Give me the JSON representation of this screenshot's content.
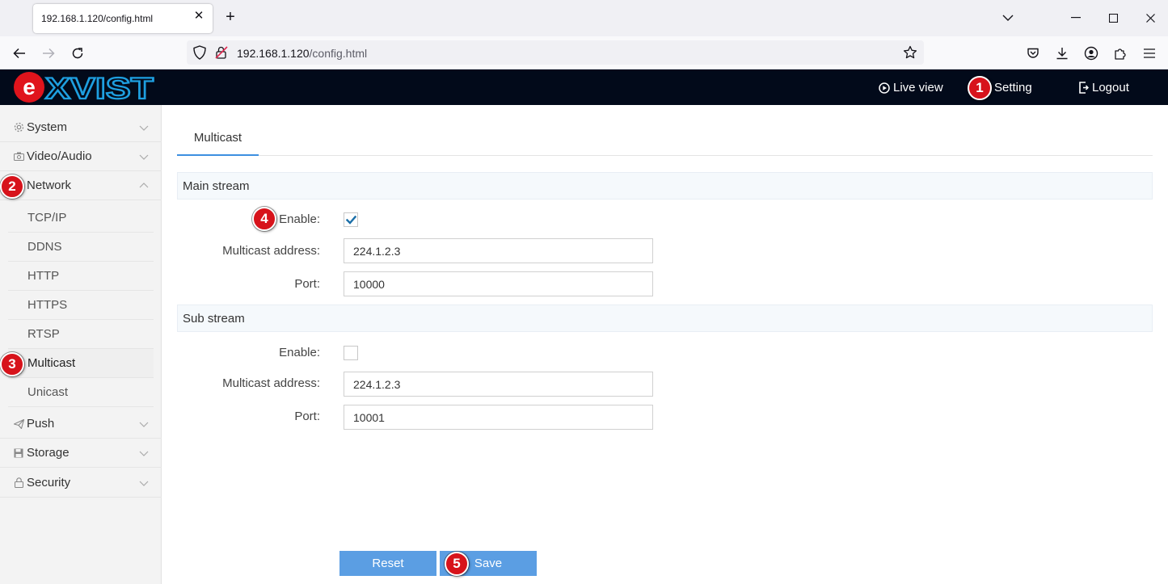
{
  "browser": {
    "tab_title": "192.168.1.120/config.html",
    "url_host": "192.168.1.120",
    "url_path": "/config.html"
  },
  "header": {
    "logo_text": "eXVIST",
    "live_view": "Live view",
    "setting": "Setting",
    "logout": "Logout"
  },
  "sidebar": {
    "items": [
      {
        "label": "System",
        "icon": "gear-icon",
        "expanded": false
      },
      {
        "label": "Video/Audio",
        "icon": "camera-icon",
        "expanded": false
      },
      {
        "label": "Network",
        "icon": "network-icon",
        "expanded": true
      },
      {
        "label": "Push",
        "icon": "send-icon",
        "expanded": false
      },
      {
        "label": "Storage",
        "icon": "floppy-icon",
        "expanded": false
      },
      {
        "label": "Security",
        "icon": "lock-icon",
        "expanded": false
      }
    ],
    "network_sub": [
      "TCP/IP",
      "DDNS",
      "HTTP",
      "HTTPS",
      "RTSP",
      "Multicast",
      "Unicast"
    ],
    "active_sub": "Multicast"
  },
  "main": {
    "tab": "Multicast",
    "main_stream": {
      "title": "Main stream",
      "enable_label": "Enable:",
      "enabled": true,
      "address_label": "Multicast address:",
      "address": "224.1.2.3",
      "port_label": "Port:",
      "port": "10000"
    },
    "sub_stream": {
      "title": "Sub stream",
      "enable_label": "Enable:",
      "enabled": false,
      "address_label": "Multicast address:",
      "address": "224.1.2.3",
      "port_label": "Port:",
      "port": "10001"
    },
    "reset_label": "Reset",
    "save_label": "Save"
  },
  "annotations": [
    "1",
    "2",
    "3",
    "4",
    "5"
  ],
  "colors": {
    "header_bg": "#020a1a",
    "accent": "#3d8fe0",
    "button": "#5b9ee3",
    "badge": "#d7131b",
    "logo_red": "#e0141c",
    "logo_blue": "#1e9fe0"
  }
}
